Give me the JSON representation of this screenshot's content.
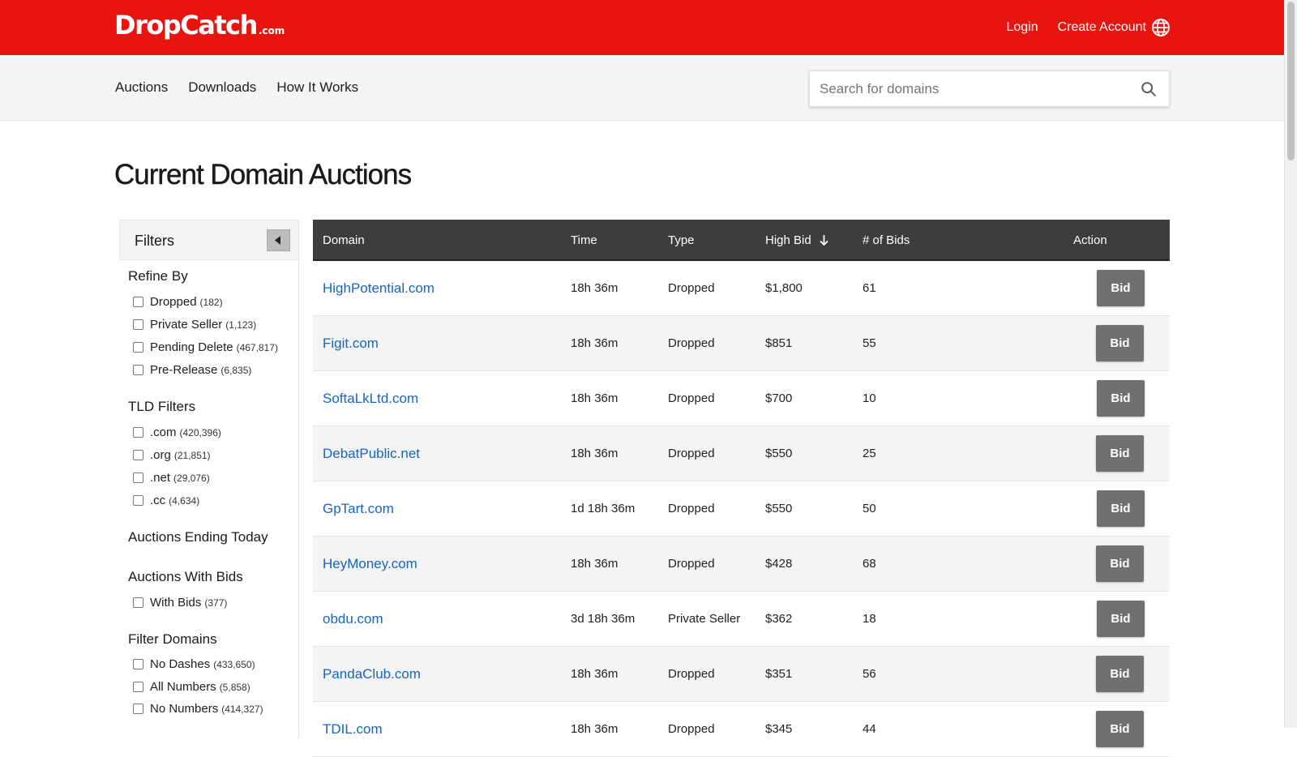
{
  "header": {
    "logo_main": "DropCatch",
    "logo_suffix": ".com",
    "login": "Login",
    "create_account": "Create Account",
    "brand_color": "#e8140f"
  },
  "nav": {
    "items": [
      "Auctions",
      "Downloads",
      "How It Works"
    ],
    "search_placeholder": "Search for domains"
  },
  "page_title": "Current Domain Auctions",
  "filters": {
    "title": "Filters",
    "refine_by": {
      "title": "Refine By",
      "items": [
        {
          "label": "Dropped",
          "count": "(182)"
        },
        {
          "label": "Private Seller",
          "count": "(1,123)"
        },
        {
          "label": "Pending Delete",
          "count": "(467,817)"
        },
        {
          "label": "Pre-Release",
          "count": "(6,835)"
        }
      ]
    },
    "tld_filters": {
      "title": "TLD Filters",
      "items": [
        {
          "label": ".com",
          "count": "(420,396)"
        },
        {
          "label": ".org",
          "count": "(21,851)"
        },
        {
          "label": ".net",
          "count": "(29,076)"
        },
        {
          "label": ".cc",
          "count": "(4,634)"
        }
      ]
    },
    "ending_today": {
      "title": "Auctions Ending Today"
    },
    "with_bids": {
      "title": "Auctions With Bids",
      "items": [
        {
          "label": "With Bids",
          "count": "(377)"
        }
      ]
    },
    "filter_domains": {
      "title": "Filter Domains",
      "items": [
        {
          "label": "No Dashes",
          "count": "(433,650)"
        },
        {
          "label": "All Numbers",
          "count": "(5,858)"
        },
        {
          "label": "No Numbers",
          "count": "(414,327)"
        }
      ]
    }
  },
  "table": {
    "headers": {
      "domain": "Domain",
      "time": "Time",
      "type": "Type",
      "high_bid": "High Bid",
      "bids": "# of Bids",
      "action": "Action"
    },
    "bid_label": "Bid",
    "rows": [
      {
        "domain": "HighPotential.com",
        "time": "18h 36m",
        "type": "Dropped",
        "high_bid": "$1,800",
        "bids": "61"
      },
      {
        "domain": "Figit.com",
        "time": "18h 36m",
        "type": "Dropped",
        "high_bid": "$851",
        "bids": "55"
      },
      {
        "domain": "SoftaLkLtd.com",
        "time": "18h 36m",
        "type": "Dropped",
        "high_bid": "$700",
        "bids": "10"
      },
      {
        "domain": "DebatPublic.net",
        "time": "18h 36m",
        "type": "Dropped",
        "high_bid": "$550",
        "bids": "25"
      },
      {
        "domain": "GpTart.com",
        "time": "1d 18h 36m",
        "type": "Dropped",
        "high_bid": "$550",
        "bids": "50"
      },
      {
        "domain": "HeyMoney.com",
        "time": "18h 36m",
        "type": "Dropped",
        "high_bid": "$428",
        "bids": "68"
      },
      {
        "domain": "obdu.com",
        "time": "3d 18h 36m",
        "type": "Private Seller",
        "high_bid": "$362",
        "bids": "18"
      },
      {
        "domain": "PandaClub.com",
        "time": "18h 36m",
        "type": "Dropped",
        "high_bid": "$351",
        "bids": "56"
      },
      {
        "domain": "TDIL.com",
        "time": "18h 36m",
        "type": "Dropped",
        "high_bid": "$345",
        "bids": "44"
      }
    ]
  }
}
